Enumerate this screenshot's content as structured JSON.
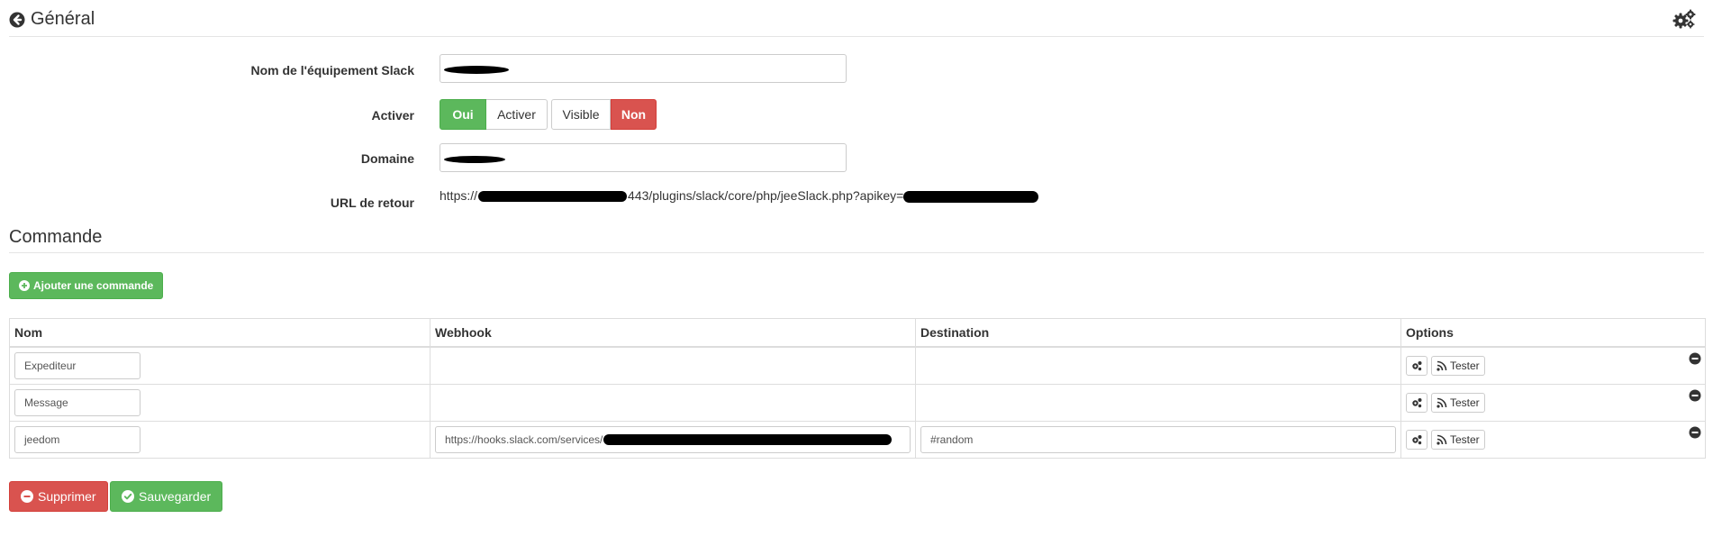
{
  "header": {
    "title": "Général"
  },
  "form": {
    "name_label": "Nom de l'équipement Slack",
    "name_value": "",
    "activate_label": "Activer",
    "toggle_enable": {
      "on": "Oui",
      "off": "Activer"
    },
    "toggle_visible": {
      "on": "Visible",
      "off": "Non"
    },
    "domain_label": "Domaine",
    "domain_value": "",
    "url_label": "URL de retour",
    "url_prefix": "https://",
    "url_middle": "443/plugins/slack/core/php/jeeSlack.php?apikey="
  },
  "commands": {
    "title": "Commande",
    "add_button": "Ajouter une commande",
    "columns": [
      "Nom",
      "Webhook",
      "Destination",
      "Options"
    ],
    "test_label": "Tester",
    "rows": [
      {
        "name": "Expediteur",
        "webhook": "",
        "destination": ""
      },
      {
        "name": "Message",
        "webhook": "",
        "destination": ""
      },
      {
        "name": "jeedom",
        "webhook": "https://hooks.slack.com/services/",
        "destination": "#random"
      }
    ]
  },
  "actions": {
    "delete": "Supprimer",
    "save": "Sauvegarder"
  },
  "colors": {
    "success": "#5cb85c",
    "danger": "#d9534f",
    "border": "#cccccc",
    "redaction": "#000000"
  },
  "icons": {
    "back": "arrow-circle-left-icon",
    "config": "cogs-icon",
    "add": "plus-circle-icon",
    "test": "rss-icon",
    "remove": "minus-circle-icon",
    "delete": "minus-circle-icon",
    "save": "check-circle-icon"
  }
}
